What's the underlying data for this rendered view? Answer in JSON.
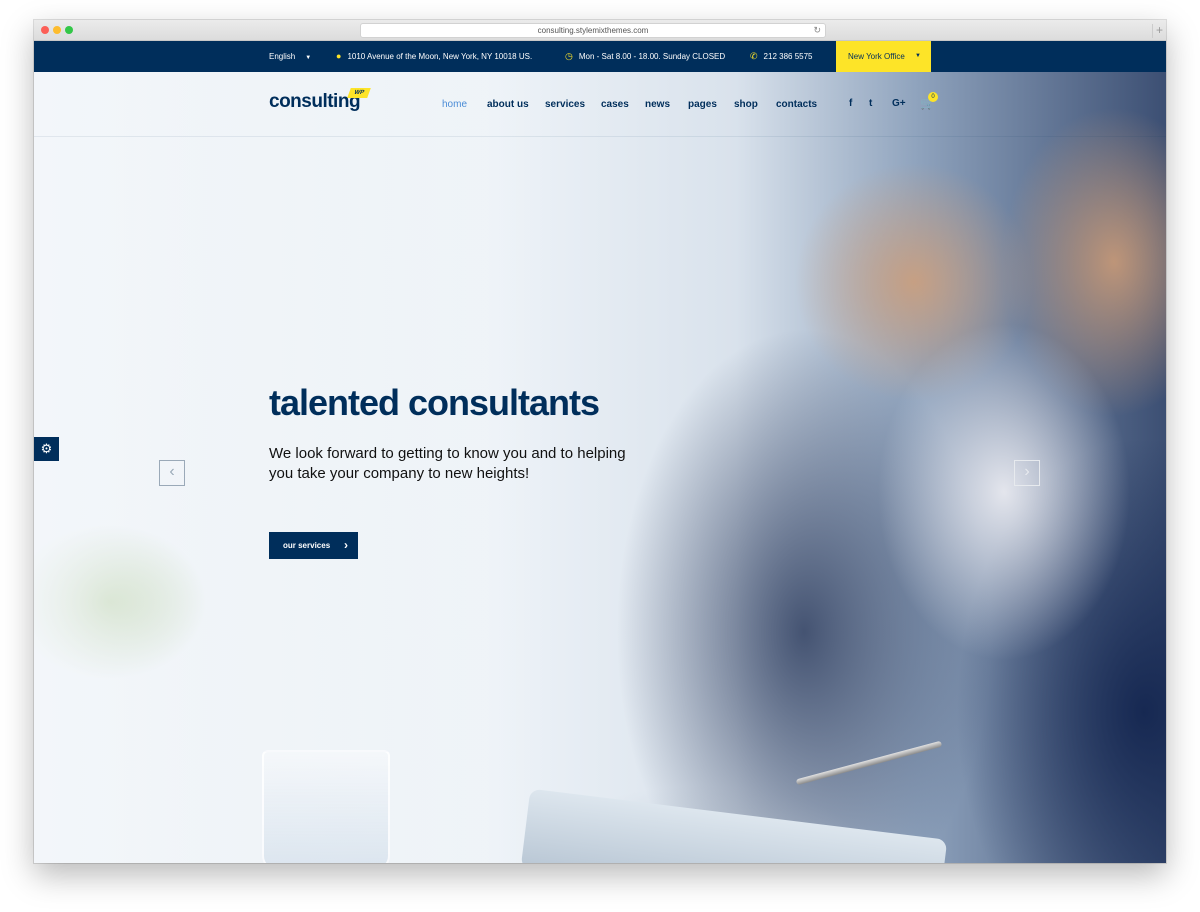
{
  "browser": {
    "url": "consulting.stylemixthemes.com",
    "reload_icon": "reload-icon",
    "new_tab": "+"
  },
  "topbar": {
    "language": "English",
    "address": "1010 Avenue of the Moon, New York, NY 10018 US.",
    "hours": "Mon - Sat 8.00 - 18.00. Sunday CLOSED",
    "phone": "212 386 5575",
    "office": "New York Office",
    "icons": {
      "address": "map-pin-icon",
      "hours": "clock-icon",
      "phone": "phone-icon"
    }
  },
  "header": {
    "logo": "consulting",
    "logo_badge": "WP",
    "nav": [
      "home",
      "about us",
      "services",
      "cases",
      "news",
      "pages",
      "shop",
      "contacts"
    ],
    "social": {
      "facebook": "f",
      "twitter": "t",
      "google_plus": "G+"
    },
    "cart_count": "0"
  },
  "hero": {
    "title": "talented consultants",
    "text": "We look forward to getting to know you and to helping you take your company to new heights!",
    "cta": "our services"
  },
  "colors": {
    "navy": "#002e5b",
    "yellow": "#fde428",
    "active_link": "#4b8cd6"
  }
}
